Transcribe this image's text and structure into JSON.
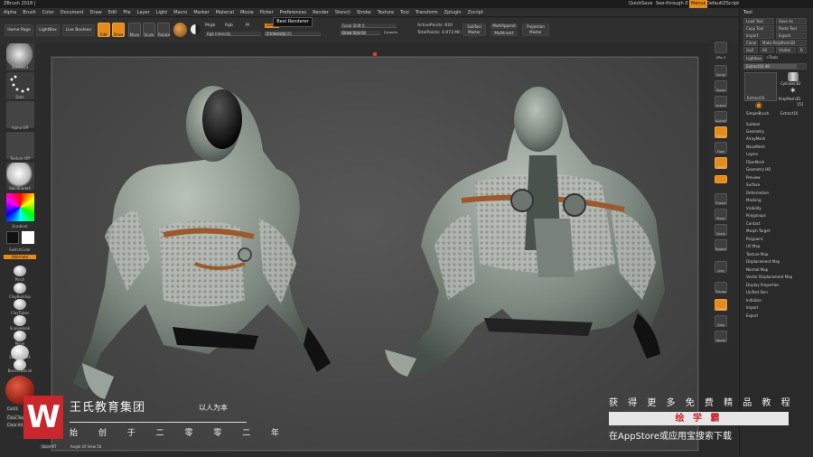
{
  "window": {
    "title": "ZBrush 2018 |"
  },
  "titlebar_right": {
    "quicksave": "QuickSave",
    "seethrough": "See-through  0",
    "menus": "Menus",
    "script": "DefaultZScript"
  },
  "menubar": [
    "Alpha",
    "Brush",
    "Color",
    "Document",
    "Draw",
    "Edit",
    "File",
    "Layer",
    "Light",
    "Macro",
    "Marker",
    "Material",
    "Movie",
    "Picker",
    "Preferences",
    "Render",
    "Stencil",
    "Stroke",
    "Texture",
    "Tool",
    "Transform",
    "Zplugin",
    "Zscript"
  ],
  "tooltip": "Best Renderer",
  "topshelf": {
    "home_page": "Home Page",
    "lightbox": "LightBox",
    "live_boolean": "Live Boolean",
    "edit": "Edit",
    "draw": "Draw",
    "move": "Move",
    "scale": "Scale",
    "rotate": "Rotate",
    "mrgb": "Mrgb",
    "rgb": "Rgb",
    "m": "M",
    "zadd": "Zadd",
    "zsub": "Zsub",
    "zcut": "Zcut",
    "focal_shift": "Focal Shift  0",
    "active_points": "ActivePoints: 620",
    "subtool_master": "SubTool Master",
    "multiappend": "MultiAppend",
    "projection_master": "Projection Master",
    "rgb_intensity": "Rgb Intensity",
    "z_intensity": "Z Intensity  25",
    "draw_size": "Draw Size  64",
    "dynamic": "Dynamic",
    "total_points": "TotalPoints: 4.973 Mil",
    "multiinsert": "MultiInsert"
  },
  "leftshelf": {
    "labels": [
      "Standard",
      "Dots",
      "Alpha Off",
      "Texture Off",
      "SkinShade4",
      "Gradient",
      "SwitchColor",
      "Alternate",
      "Pinch",
      "ClayBuildup",
      "ClayTubes",
      "SnakeHook",
      "Move",
      "SkinShade4",
      "BasicMaterial",
      "Cust1",
      "Cust2",
      "Clear Tex",
      "Clear All"
    ]
  },
  "bottombar": {
    "store": "StoreMT",
    "angle": "Angle Of View 50"
  },
  "tool_panel": {
    "title": "Tool",
    "buttons": [
      "Load Tool",
      "Save As",
      "Copy Tool",
      "Paste Tool",
      "Import",
      "Export",
      "Clone",
      "Make PolyMesh3D",
      "GoZ",
      "All",
      "Visible",
      "R",
      "Lightbox",
      ">Tools"
    ],
    "extract_slider": "Extract16  48",
    "thumbnails": [
      "Extract16",
      "Cylinder3D",
      "PolyMesh3D",
      "SimpleBrush",
      "Extract16"
    ],
    "thumb_count": "151",
    "subpalettes": [
      "Subtool",
      "Geometry",
      "ArrayMesh",
      "NanoMesh",
      "Layers",
      "FiberMesh",
      "Geometry HD",
      "Preview",
      "Surface",
      "Deformation",
      "Masking",
      "Visibility",
      "Polygroups",
      "Contact",
      "Morph Target",
      "Polypaint",
      "UV Map",
      "Texture Map",
      "Displacement Map",
      "Normal Map",
      "Vector Displacement Map",
      "Display Properties",
      "Unified Skin",
      "Initialize",
      "Import",
      "Export"
    ]
  },
  "right_shelf": [
    "SPix 3",
    "Scroll",
    "Zoom",
    "Actual",
    "AAHalf",
    "Persp",
    "Floor",
    "Local",
    "Frame",
    "Move",
    "Scale",
    "Rotate",
    "Line Fill",
    "Transp",
    "Ghost",
    "Solo",
    "Xpose"
  ],
  "watermark": {
    "brand": "王氏教育集团",
    "slogan": "以人为本",
    "subline": "始 创 于 二 零 零 二 年",
    "right_top": "获 得 更 多 免 费 精 品 教 程",
    "band": "绘 学 霸",
    "right_bottom": "在AppStore或应用宝搜索下载",
    "logo_letter": "W"
  },
  "colors": {
    "accent": "#e58b1a",
    "watermark_red": "#c9262d",
    "armor": "#8a968c",
    "copper": "#9a5a2e"
  }
}
